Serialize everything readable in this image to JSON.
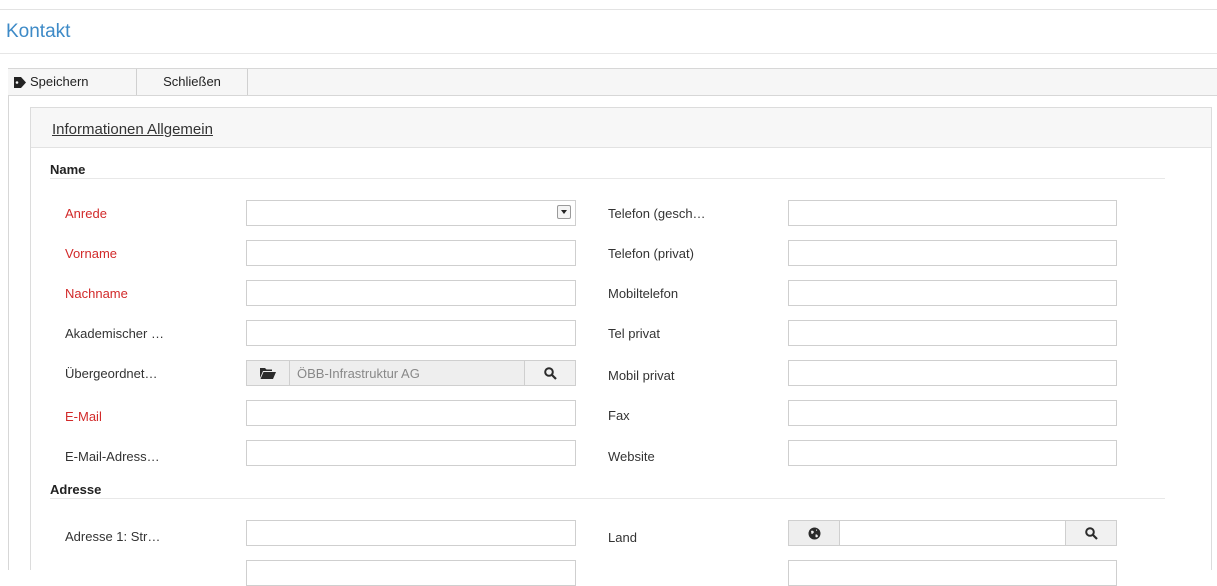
{
  "page": {
    "title": "Kontakt"
  },
  "toolbar": {
    "save_label": "Speichern",
    "close_label": "Schließen"
  },
  "panel": {
    "title": "Informationen Allgemein"
  },
  "sections": {
    "name": "Name",
    "address": "Adresse"
  },
  "fields_left": {
    "anrede": "Anrede",
    "vorname": "Vorname",
    "nachname": "Nachname",
    "akademischer": "Akademischer …",
    "uebergeordnet": "Übergeordnet…",
    "email": "E-Mail",
    "email_adresse": "E-Mail-Adress…",
    "adresse1": "Adresse 1: Str…"
  },
  "fields_right": {
    "telefon_gesch": "Telefon (gesch…",
    "telefon_privat": "Telefon (privat)",
    "mobiltelefon": "Mobiltelefon",
    "tel_privat": "Tel privat",
    "mobil_privat": "Mobil privat",
    "fax": "Fax",
    "website": "Website",
    "land": "Land"
  },
  "values": {
    "uebergeordnet": "ÖBB-Infrastruktur AG"
  },
  "icons": {
    "save": "tag-icon",
    "folder": "folder-open-icon",
    "search": "search-icon",
    "globe": "globe-icon"
  },
  "colors": {
    "title": "#3d8ac7",
    "required": "#d22a2a"
  }
}
